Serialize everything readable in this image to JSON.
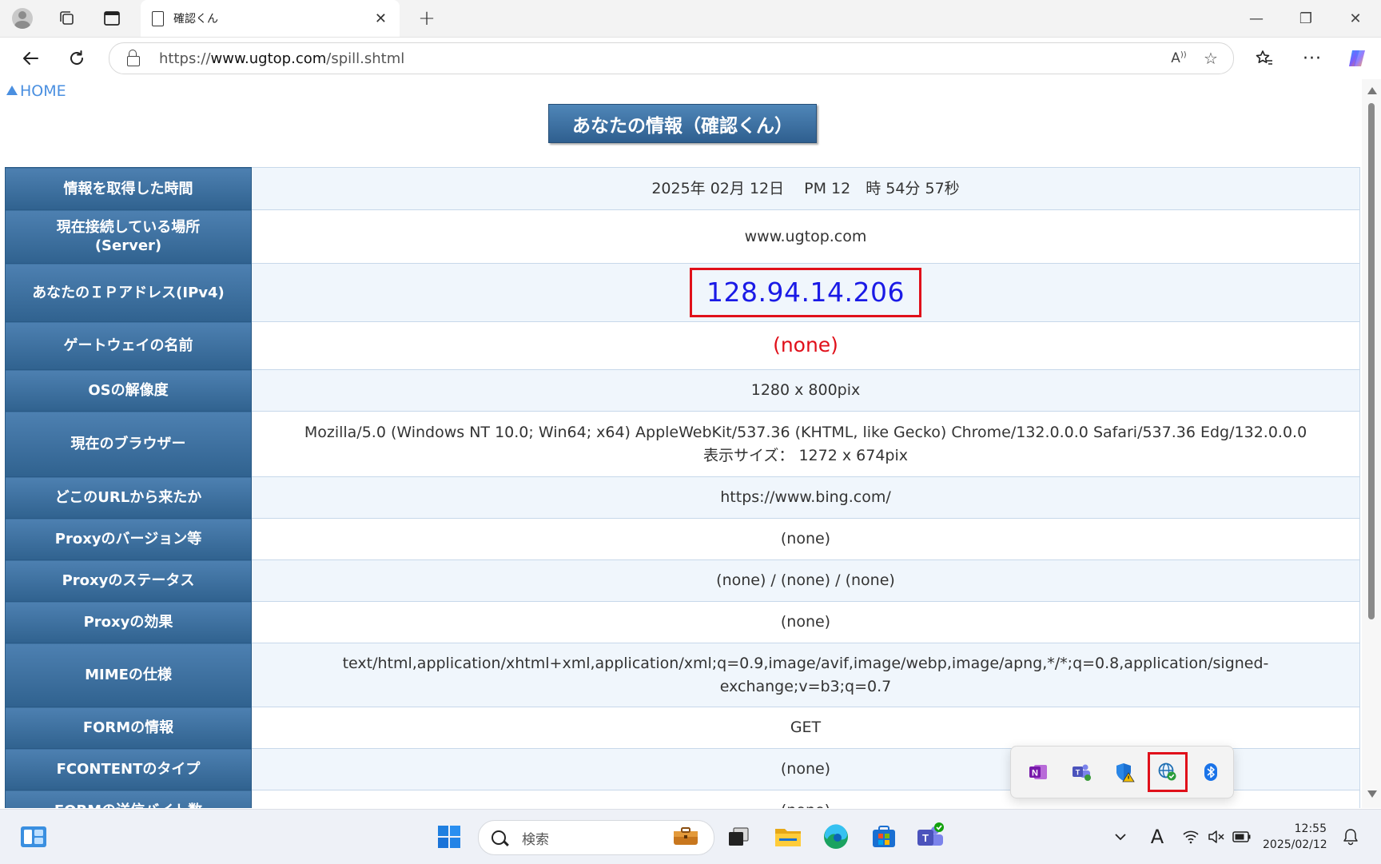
{
  "browser": {
    "tab_title": "確認くん",
    "tab_close": "✕",
    "new_tab": "+",
    "url_prefix": "https://",
    "url_host": "www.ugtop.com",
    "url_path": "/spill.shtml",
    "window_controls": {
      "minimize": "—",
      "restore": "❐",
      "close": "✕"
    }
  },
  "page": {
    "home_link": "HOME",
    "title": "あなたの情報（確認くん）",
    "rows": [
      {
        "label": "情報を取得した時間",
        "value": "2025年 02月 12日　 PM 12　時 54分 57秒"
      },
      {
        "label": "現在接続している場所\n(Server)",
        "value": "www.ugtop.com"
      },
      {
        "label": "あなたのＩＰアドレス(IPv4)",
        "value": "128.94.14.206"
      },
      {
        "label": "ゲートウェイの名前",
        "value": "(none)"
      },
      {
        "label": "OSの解像度",
        "value": "1280 x 800pix"
      },
      {
        "label": "現在のブラウザー",
        "value": "Mozilla/5.0 (Windows NT 10.0; Win64; x64) AppleWebKit/537.36 (KHTML, like Gecko) Chrome/132.0.0.0 Safari/537.36 Edg/132.0.0.0",
        "value2": "表示サイズ：  1272 x 674pix"
      },
      {
        "label": "どこのURLから来たか",
        "value": "https://www.bing.com/"
      },
      {
        "label": "Proxyのバージョン等",
        "value": "(none)"
      },
      {
        "label": "Proxyのステータス",
        "value": "(none) / (none) / (none)"
      },
      {
        "label": "Proxyの効果",
        "value": "(none)"
      },
      {
        "label": "MIMEの仕様",
        "value": "text/html,application/xhtml+xml,application/xml;q=0.9,image/avif,image/webp,image/apng,*/*;q=0.8,application/signed-exchange;v=b3;q=0.7"
      },
      {
        "label": "FORMの情報",
        "value": "GET"
      },
      {
        "label": "FCONTENTのタイプ",
        "value": "(none)"
      },
      {
        "label": "FORMの送信バイト数",
        "value": "(none)"
      }
    ]
  },
  "tray_popup": {
    "icons": [
      "onenote-icon",
      "teams-icon",
      "defender-warning-icon",
      "network-globe-check-icon",
      "bluetooth-icon"
    ]
  },
  "taskbar": {
    "search_placeholder": "検索",
    "time": "12:55",
    "date": "2025/02/12",
    "ime_indicator": "A"
  },
  "colors": {
    "label_bg": "#30628f",
    "highlight": "#e0101a",
    "ip_text": "#1a1ae6",
    "link": "#4a8fe0"
  }
}
